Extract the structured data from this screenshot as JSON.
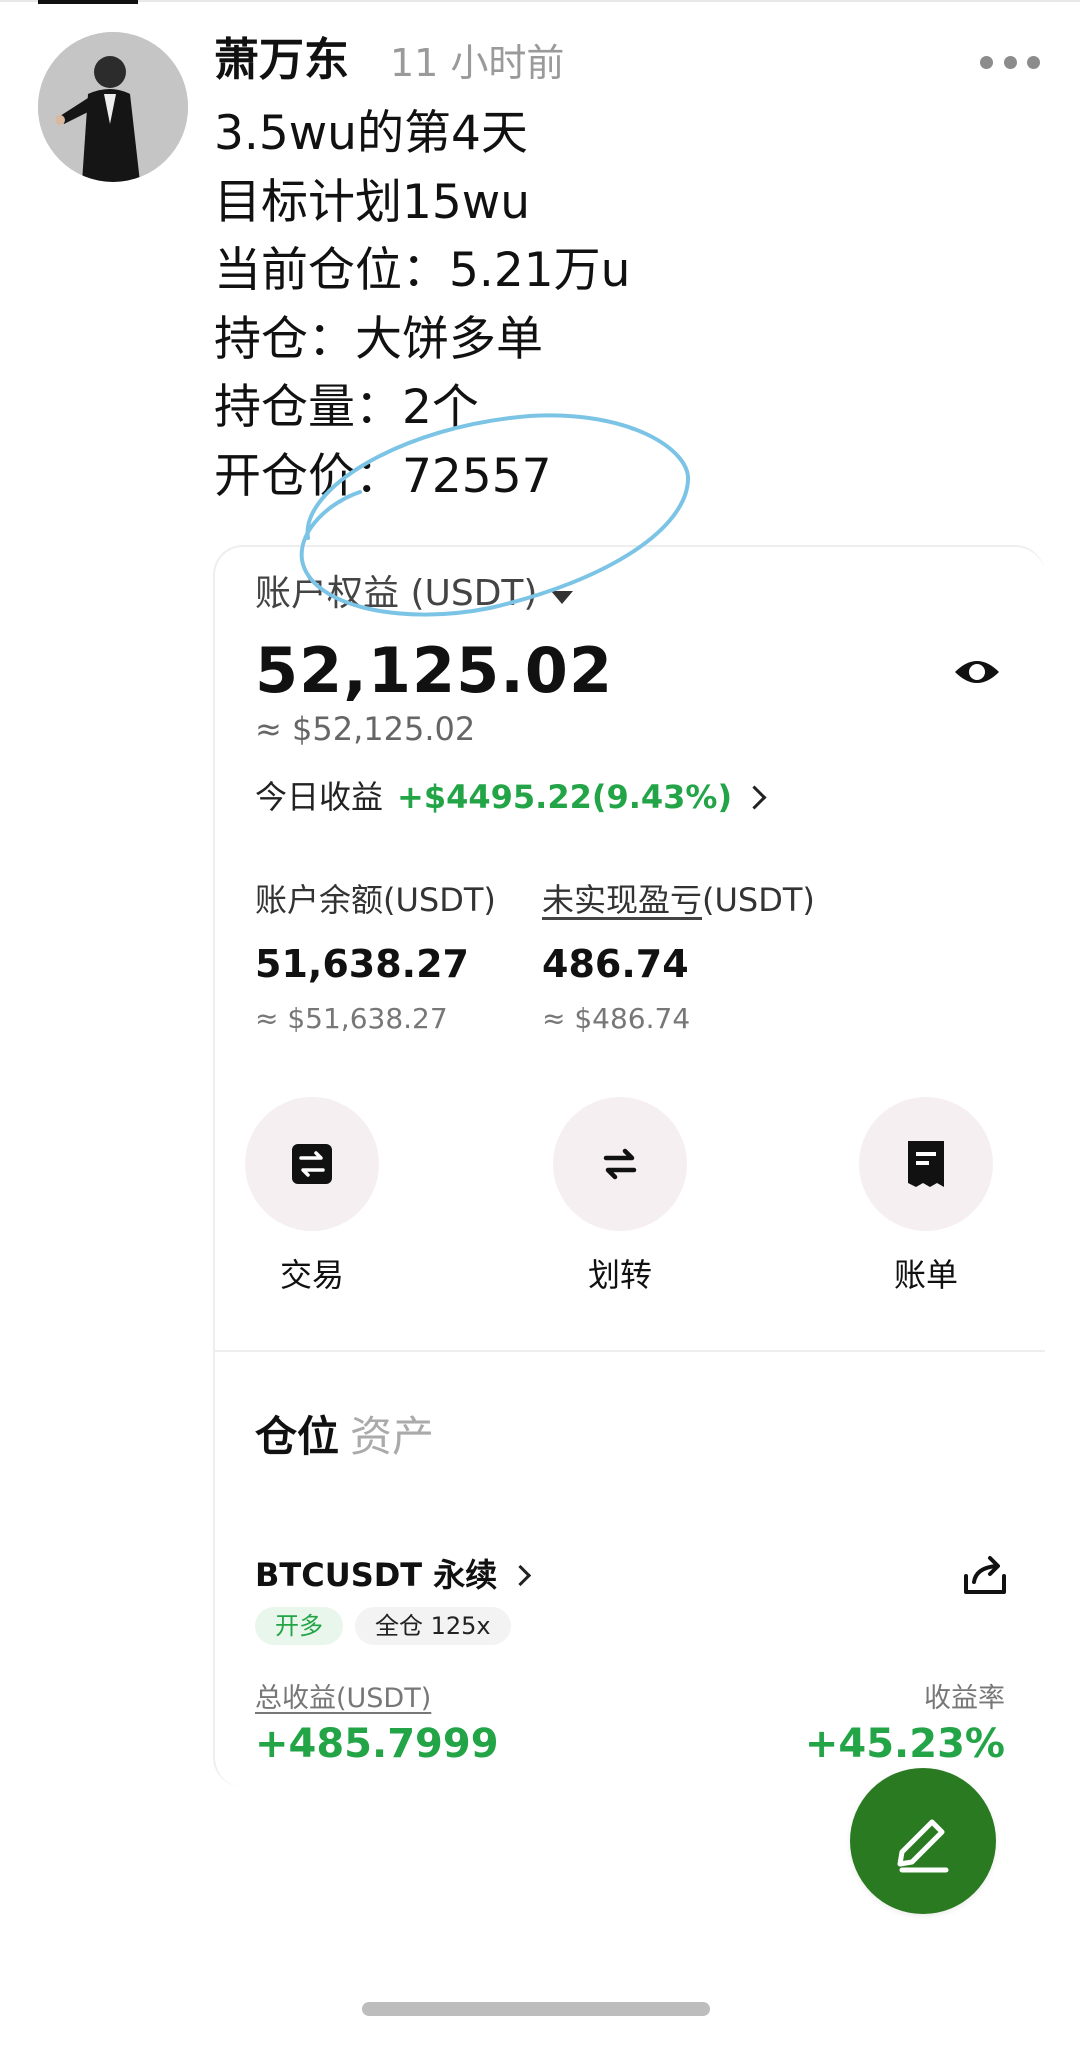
{
  "post": {
    "username": "萧万东",
    "time": "11 小时前",
    "lines": [
      "3.5wu的第4天",
      "目标计划15wu",
      "当前仓位：5.21万u",
      "持仓：大饼多单",
      "持仓量：2个",
      "开仓价：72557"
    ]
  },
  "account": {
    "equity_label": "账户权益 (USDT)",
    "equity_value": "52,125.02",
    "equity_usd": "≈ $52,125.02",
    "today_label": "今日收益",
    "today_value": "+$4495.22(9.43%)",
    "balance": {
      "label": "账户余额(USDT)",
      "value": "51,638.27",
      "usd": "≈ $51,638.27"
    },
    "unrealized": {
      "label_underlined": "未实现盈亏",
      "label_suffix": "(USDT)",
      "value": "486.74",
      "usd": "≈ $486.74"
    }
  },
  "actions": [
    {
      "label": "交易",
      "icon": "trade-icon"
    },
    {
      "label": "划转",
      "icon": "transfer-icon"
    },
    {
      "label": "账单",
      "icon": "bill-icon"
    }
  ],
  "tabs": [
    {
      "label": "仓位",
      "active": true
    },
    {
      "label": "资产",
      "active": false
    }
  ],
  "position": {
    "symbol": "BTCUSDT 永续",
    "side_badge": "开多",
    "margin_badge": "全仓 125x",
    "pnl_label": "总收益(USDT)",
    "pnl_value": "+485.7999",
    "rate_label": "收益率",
    "rate_value": "+45.23%"
  },
  "colors": {
    "gain": "#22a447",
    "fab": "#2a7a22",
    "annotation": "#7cc4e6"
  }
}
